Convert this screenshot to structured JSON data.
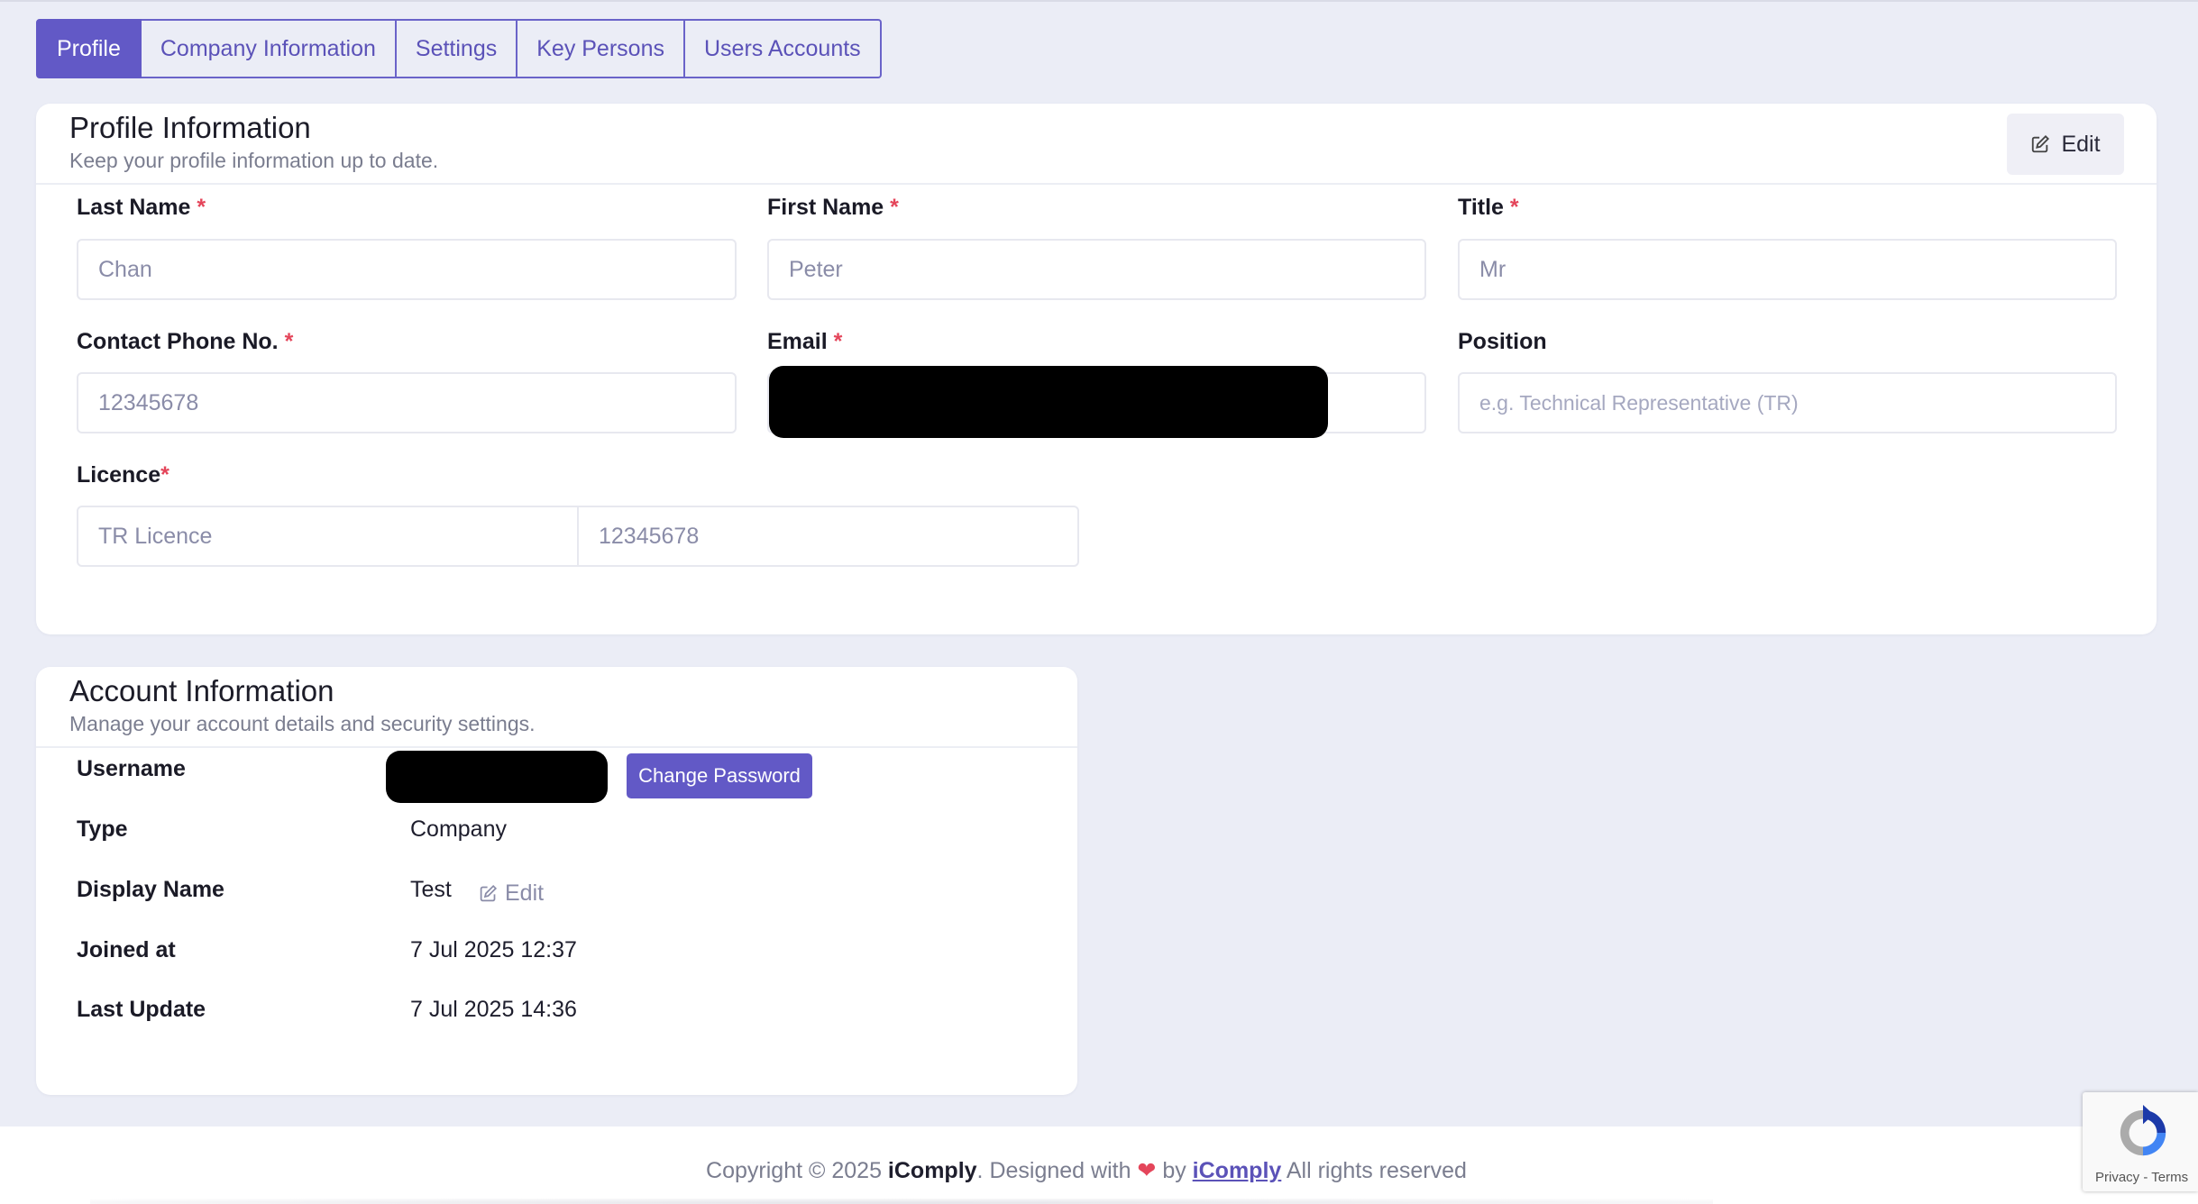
{
  "tabs": [
    {
      "label": "Profile",
      "active": true
    },
    {
      "label": "Company Information",
      "active": false
    },
    {
      "label": "Settings",
      "active": false
    },
    {
      "label": "Key Persons",
      "active": false
    },
    {
      "label": "Users Accounts",
      "active": false
    }
  ],
  "profile": {
    "title": "Profile Information",
    "subtitle": "Keep your profile information up to date.",
    "edit_label": "Edit",
    "fields": {
      "last_name": {
        "label": "Last Name",
        "value": "Chan"
      },
      "first_name": {
        "label": "First Name",
        "value": "Peter"
      },
      "title": {
        "label": "Title",
        "value": "Mr"
      },
      "phone": {
        "label": "Contact Phone No.",
        "value": "12345678"
      },
      "email": {
        "label": "Email",
        "value": ""
      },
      "position": {
        "label": "Position",
        "value": "",
        "placeholder": "e.g. Technical Representative (TR)"
      },
      "licence": {
        "label": "Licence",
        "type": "TR Licence",
        "number": "12345678"
      }
    },
    "required_mark": "*"
  },
  "account": {
    "title": "Account Information",
    "subtitle": "Manage your account details and security settings.",
    "change_password_label": "Change Password",
    "rows": {
      "username": {
        "label": "Username"
      },
      "type": {
        "label": "Type",
        "value": "Company"
      },
      "display_name": {
        "label": "Display Name",
        "value": "Test",
        "edit_label": "Edit"
      },
      "joined": {
        "label": "Joined at",
        "value": "7 Jul 2025 12:37"
      },
      "updated": {
        "label": "Last Update",
        "value": "7 Jul 2025 14:36"
      }
    }
  },
  "footer": {
    "prefix": "Copyright © 2025 ",
    "brand": "iComply",
    "designed": ". Designed with ",
    "by": " by ",
    "link": "iComply",
    "suffix": " All rights reserved"
  },
  "recaptcha": {
    "links": "Privacy - Terms"
  },
  "colors": {
    "accent": "#6259c6",
    "required": "#e4455a",
    "background": "#ebedf6"
  }
}
